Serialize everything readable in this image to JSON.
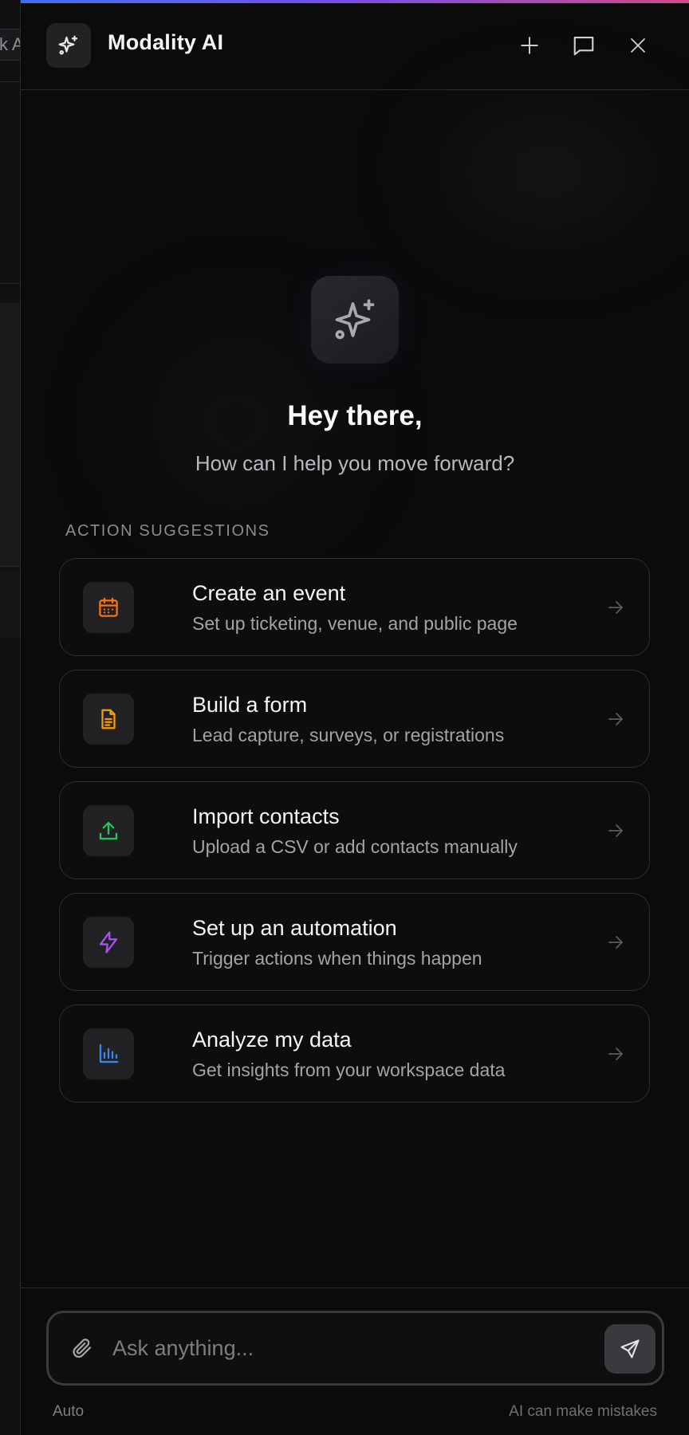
{
  "background_app": {
    "tab_fragment": "k A"
  },
  "header": {
    "title": "Modality AI",
    "new_chat_icon": "plus-icon",
    "history_icon": "message-square-icon",
    "close_icon": "close-icon"
  },
  "hero": {
    "icon": "sparkles-icon",
    "greeting": "Hey there,",
    "subtitle": "How can I help you move forward?"
  },
  "suggestions": {
    "label": "ACTION SUGGESTIONS",
    "items": [
      {
        "title": "Create an event",
        "description": "Set up ticketing, venue, and public page",
        "icon": "calendar-icon",
        "color": "#f97316"
      },
      {
        "title": "Build a form",
        "description": "Lead capture, surveys, or registrations",
        "icon": "file-text-icon",
        "color": "#f59e0b"
      },
      {
        "title": "Import contacts",
        "description": "Upload a CSV or add contacts manually",
        "icon": "upload-icon",
        "color": "#22c55e"
      },
      {
        "title": "Set up an automation",
        "description": "Trigger actions when things happen",
        "icon": "zap-icon",
        "color": "#a855f7"
      },
      {
        "title": "Analyze my data",
        "description": "Get insights from your workspace data",
        "icon": "bar-chart-icon",
        "color": "#3b82f6"
      }
    ]
  },
  "composer": {
    "placeholder": "Ask anything...",
    "value": "",
    "mode": "Auto",
    "disclaimer": "AI can make mistakes"
  },
  "colors": {
    "accent_gradient": [
      "#3f6ff0",
      "#7a4fe0",
      "#d04a8a"
    ],
    "background": "#0b0b0c",
    "card_border": "#2e2e32"
  }
}
